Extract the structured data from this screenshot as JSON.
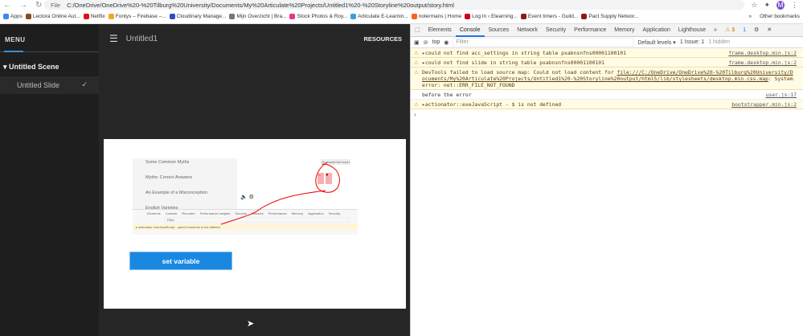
{
  "browser": {
    "nav": [
      "←",
      "→",
      "↻"
    ],
    "file_label": "File",
    "url": "C:/OneDrive/OneDrive%20-%20Tilburg%20University/Documents/My%20Articulate%20Projects/Untitled1%20-%20Storyline%20output/story.html",
    "profile_initial": "M",
    "bookmarks": [
      {
        "label": "Apps",
        "color": "#4285f4"
      },
      {
        "label": "Lectora Online Aut...",
        "color": "#8a4a1c"
      },
      {
        "label": "Netflix",
        "color": "#e50914"
      },
      {
        "label": "Fontys – Firebase –...",
        "color": "#f5a623"
      },
      {
        "label": "Cloudinary Manage...",
        "color": "#3448c5"
      },
      {
        "label": "Mijn Overzicht | Bra...",
        "color": "#777"
      },
      {
        "label": "Stock Photos & Roy...",
        "color": "#e8348a"
      },
      {
        "label": "Articulate E-Learnin...",
        "color": "#3a9ee0"
      },
      {
        "label": "notermans | Home",
        "color": "#f26522"
      },
      {
        "label": "Log In ‹ Elearning...",
        "color": "#d0021b"
      },
      {
        "label": "Event timers - Guild...",
        "color": "#8b1a1a"
      },
      {
        "label": "Pact Supply Networ...",
        "color": "#8b1a1a"
      }
    ],
    "more": "»",
    "other_bookmarks": "Other bookmarks"
  },
  "player": {
    "menu_label": "MENU",
    "scene": "Untitled Scene",
    "slide": "Untitled Slide",
    "title": "Untitled1",
    "resources": "RESOURCES",
    "button": "set variable",
    "embedded": {
      "items": [
        "Some Common Myths",
        "Myths: Correct Answers",
        "An Example of a Misconception",
        "English Varieties"
      ],
      "caption": "Or should the food t",
      "tabs": [
        "Elements",
        "Console",
        "Recorder",
        "Performance insights",
        "Sources",
        "Network",
        "Performance",
        "Memory",
        "Application",
        "Security"
      ],
      "filter": "Filter",
      "error": "▸ actionator::exeJavaScript - openComments is not defined"
    }
  },
  "devtools": {
    "tabs": [
      "Elements",
      "Console",
      "Sources",
      "Network",
      "Security",
      "Performance",
      "Memory",
      "Application",
      "Lighthouse",
      "»"
    ],
    "warnings": "3",
    "messages": "1",
    "context": "top",
    "filter_placeholder": "Filter",
    "levels": "Default levels ▾",
    "issues": "1 Issue: 1",
    "hidden": "1 hidden",
    "rows": [
      {
        "type": "warn",
        "text": "▸could not find acc_settings in string table pxabnsnfns00001100101",
        "src": "frame.desktop.min.js:2"
      },
      {
        "type": "warn",
        "text": "▸could not find slide in string table pxabnsnfns00001100101",
        "src": "frame.desktop.min.js:2"
      },
      {
        "type": "warn",
        "text": "DevTools failed to load source map: Could not load content for ",
        "link": "file:///C:/OneDrive/OneDrive%20-%20Tilburg%20University/Documents/My%20Articulate%20Projects/Untitled1%20-%20Storyline%20output/html5/lib/stylesheets/desktop.min.css.map",
        "tail": ": System error: net::ERR_FILE_NOT_FOUND",
        "src": ""
      },
      {
        "type": "log",
        "text": "before the error",
        "src": "user.js:17"
      },
      {
        "type": "warn",
        "text": "▸actionator::exeJavaScript - $ is not defined",
        "src": "bootstrapper.min.js:2"
      }
    ],
    "prompt": "›"
  }
}
